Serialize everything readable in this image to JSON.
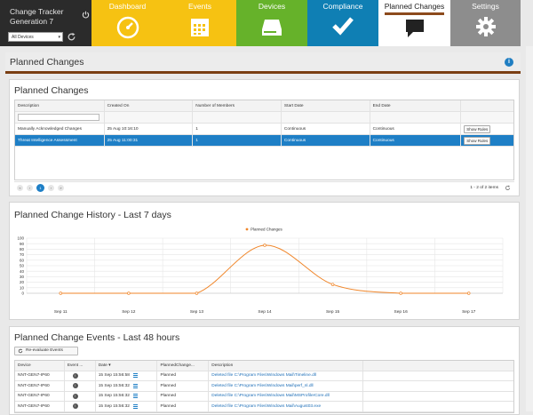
{
  "brand": {
    "line1": "Change Tracker",
    "line2": "Generation 7",
    "device_filter": "All Devices"
  },
  "nav": {
    "dashboard": "Dashboard",
    "events": "Events",
    "devices": "Devices",
    "compliance": "Compliance",
    "planned": "Planned Changes",
    "settings": "Settings"
  },
  "page_title": "Planned Changes",
  "planned": {
    "title": "Planned Changes",
    "columns": [
      "Description",
      "Created On",
      "Number of Members",
      "Start Date",
      "End Date"
    ],
    "rows": [
      {
        "description": "Manually Acknowledged Changes",
        "created": "25 Aug 10:16:10",
        "members": "1",
        "start": "Continuous",
        "end": "Continuous",
        "button": "Show Rules"
      },
      {
        "description": "Threat Intelligence Assessment",
        "created": "25 Aug 11:00:31",
        "members": "1",
        "start": "Continuous",
        "end": "Continuous",
        "button": "Show Rules"
      }
    ],
    "pager": {
      "current_page": "1",
      "info": "1 - 2 of 2 items"
    }
  },
  "history": {
    "title": "Planned Change History - Last 7 days"
  },
  "chart_data": {
    "type": "line",
    "categories": [
      "Sep 11",
      "Sep 12",
      "Sep 13",
      "Sep 14",
      "Sep 15",
      "Sep 16",
      "Sep 17"
    ],
    "series": [
      {
        "name": "Planned Changes",
        "values": [
          0,
          0,
          0,
          87,
          16,
          0,
          0
        ],
        "color": "#f0862a"
      }
    ],
    "ylim": [
      0,
      100
    ],
    "yticks": [
      "100",
      "90",
      "80",
      "70",
      "60",
      "50",
      "40",
      "30",
      "20",
      "10",
      "0"
    ],
    "legend": "top-center",
    "grid": true
  },
  "events": {
    "title": "Planned Change Events - Last 48 hours",
    "reevaluate": "Re-evaluate Events",
    "columns": [
      "Device",
      "Event ...",
      "Date ▾",
      "PlannedChange...",
      "Description"
    ],
    "rows": [
      {
        "device": "NNT-GEN7-IP60",
        "date": "15 Sep 15:56:58",
        "status": "Planned",
        "desc": "Deleted file C:\\Program Files\\Windows Mail\\Timeline.dll"
      },
      {
        "device": "NNT-GEN7-IP60",
        "date": "15 Sep 15:56:32",
        "status": "Planned",
        "desc": "Deleted file C:\\Program Files\\Windows Mail\\perf_nl.dll"
      },
      {
        "device": "NNT-GEN7-IP60",
        "date": "15 Sep 15:56:32",
        "status": "Planned",
        "desc": "Deleted file C:\\Program Files\\Windows Mail\\MSProfilerCore.dll"
      },
      {
        "device": "NNT-GEN7-IP60",
        "date": "15 Sep 15:56:32",
        "status": "Planned",
        "desc": "Deleted file C:\\Program Files\\Windows Mail\\August03.exe"
      }
    ]
  }
}
